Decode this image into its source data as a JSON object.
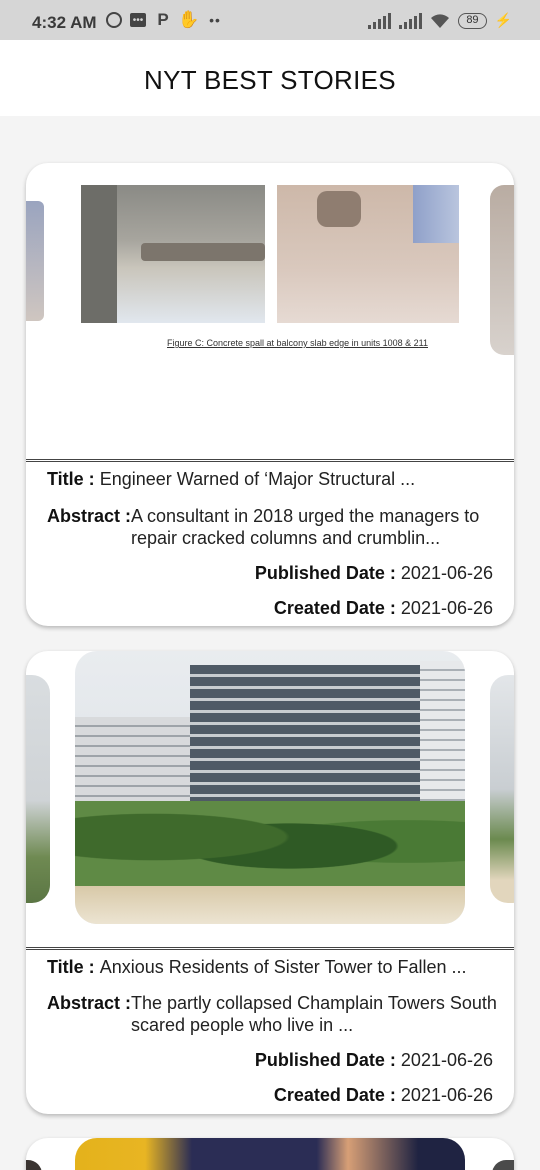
{
  "status_bar": {
    "time": "4:32 AM",
    "battery": "89",
    "icons": [
      "alarm-icon",
      "message-icon",
      "p-icon",
      "hand-wave-icon",
      "more-dots-icon",
      "signal-icon",
      "signal-icon",
      "wifi-icon",
      "battery-icon",
      "charging-icon"
    ]
  },
  "app_bar": {
    "title": "NYT BEST STORIES"
  },
  "labels": {
    "title": "Title : ",
    "abstract": "Abstract : ",
    "published": "Published Date : ",
    "created": "Created Date : "
  },
  "stories": [
    {
      "image_caption": "Figure C: Concrete spall at balcony slab edge in units 1008 & 211",
      "title": "Engineer Warned of ‘Major Structural ...",
      "abstract": "A consultant in 2018 urged the managers to repair cracked columns and crumblin...",
      "published_date": "2021-06-26",
      "created_date": "2021-06-26"
    },
    {
      "title": "Anxious Residents of Sister Tower to Fallen ...",
      "abstract": "The partly collapsed Champlain Towers South scared people who live in ...",
      "published_date": "2021-06-26",
      "created_date": "2021-06-26"
    }
  ]
}
